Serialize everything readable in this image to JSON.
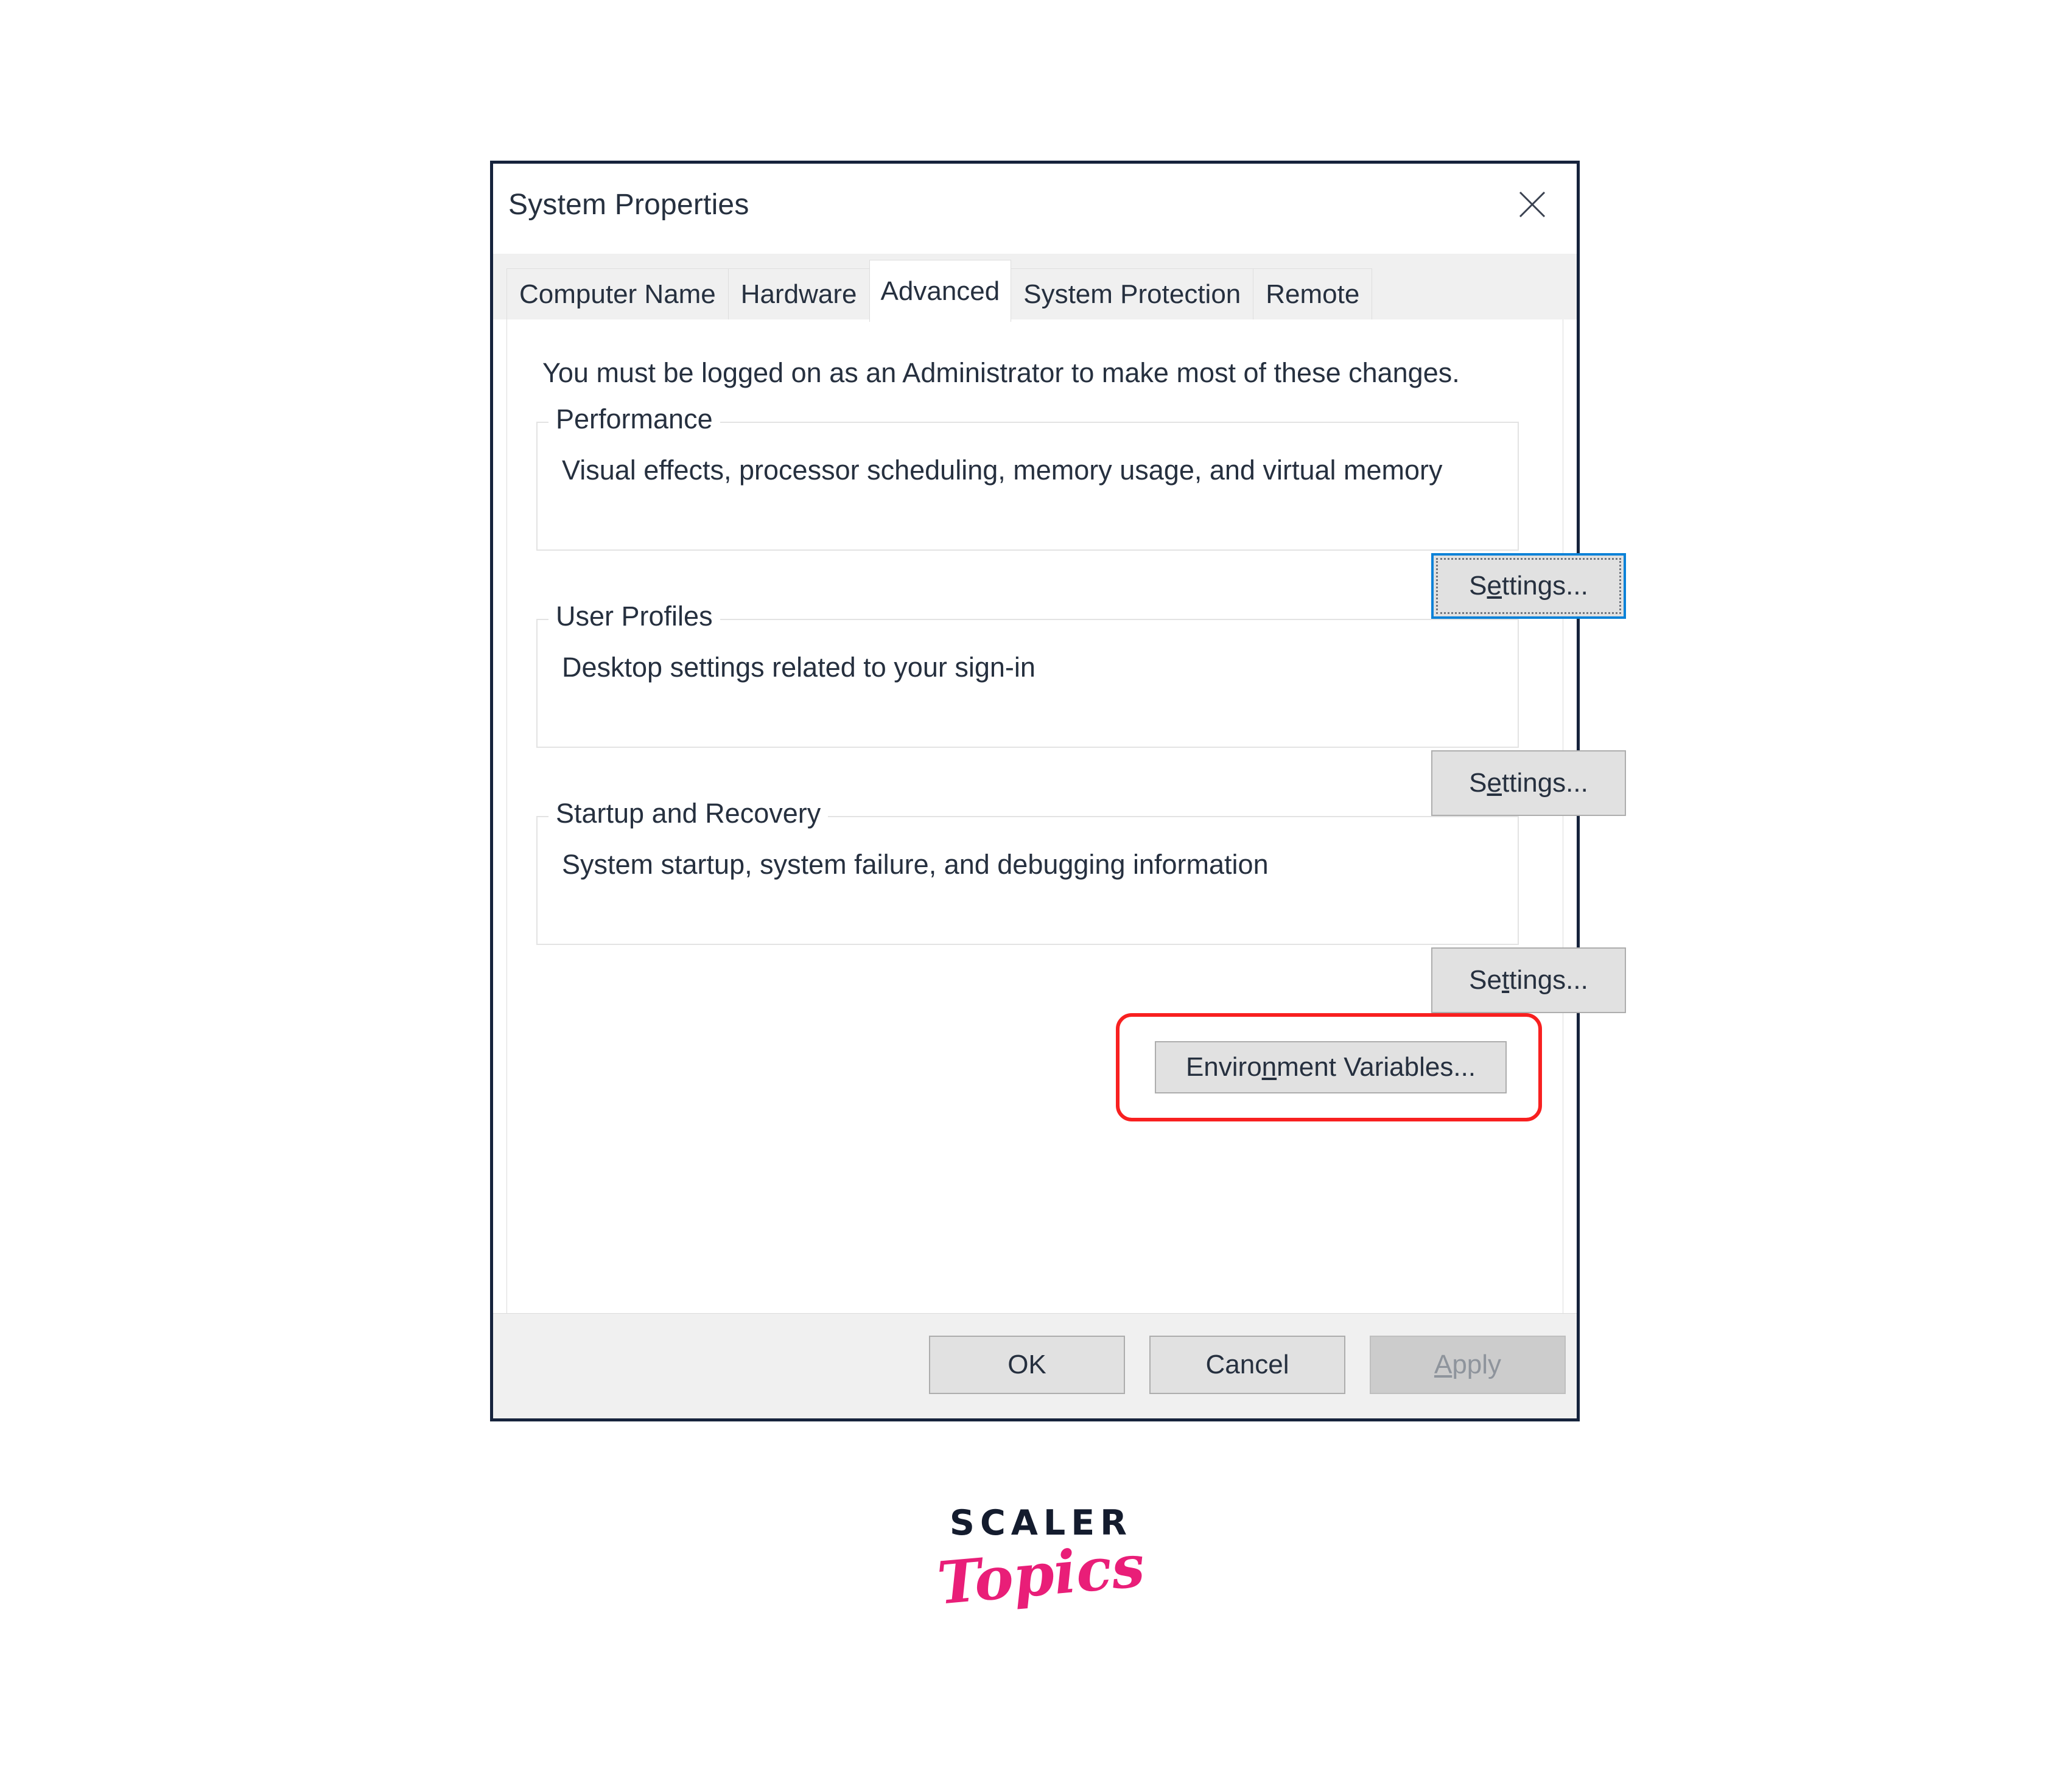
{
  "window": {
    "title": "System Properties",
    "close_icon": "close-icon"
  },
  "tabs": [
    {
      "label": "Computer Name",
      "active": false
    },
    {
      "label": "Hardware",
      "active": false
    },
    {
      "label": "Advanced",
      "active": true
    },
    {
      "label": "System Protection",
      "active": false
    },
    {
      "label": "Remote",
      "active": false
    }
  ],
  "panel": {
    "note": "You must be logged on as an Administrator to make most of these changes."
  },
  "groups": [
    {
      "legend": "Performance",
      "description": "Visual effects, processor scheduling, memory usage, and virtual memory",
      "button": {
        "label": "Settings...",
        "accel_before": "S",
        "accel": "e",
        "accel_after": "ttings...",
        "focused": true
      }
    },
    {
      "legend": "User Profiles",
      "description": "Desktop settings related to your sign-in",
      "button": {
        "label": "Settings...",
        "accel_before": "S",
        "accel": "e",
        "accel_after": "ttings...",
        "focused": false
      }
    },
    {
      "legend": "Startup and Recovery",
      "description": "System startup, system failure, and debugging information",
      "button": {
        "label": "Settings...",
        "accel_before": "Se",
        "accel": "t",
        "accel_after": "tings...",
        "focused": false
      }
    }
  ],
  "environment_variables_button": {
    "label": "Environment Variables...",
    "accel_before": "Enviro",
    "accel": "n",
    "accel_after": "ment Variables...",
    "highlighted": true
  },
  "footer": {
    "ok_label": "OK",
    "cancel_label": "Cancel",
    "apply_before": "",
    "apply_accel": "A",
    "apply_after": "pply",
    "apply_enabled": false
  },
  "branding": {
    "name": "SCALER",
    "sub": "Topics"
  },
  "colors": {
    "window_border": "#16233c",
    "focus_blue": "#0a82d8",
    "annotation_red": "#f82020",
    "button_face": "#e1e1e1",
    "disabled_face": "#cccccc",
    "brand_dark": "#141c2e",
    "brand_pink": "#e91e78"
  }
}
